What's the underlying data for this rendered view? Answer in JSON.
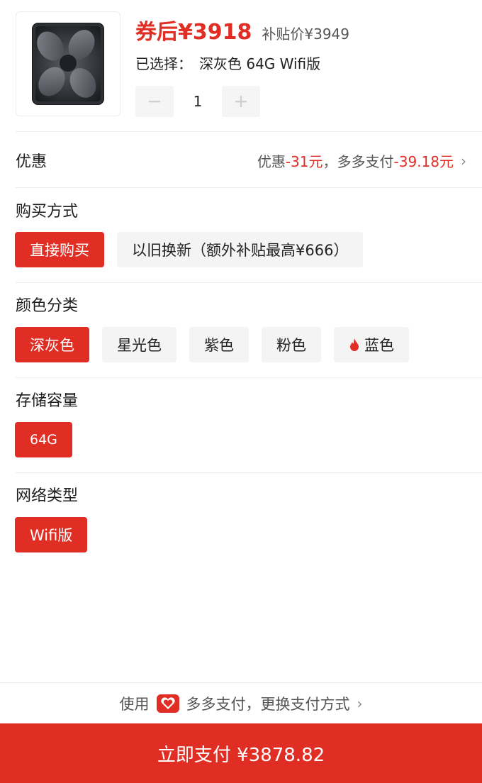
{
  "product": {
    "coupon_price": "券后¥3918",
    "subsidy_price": "补贴价¥3949",
    "selected_label": "已选择：",
    "selected_value": "深灰色 64G Wifi版",
    "quantity": "1",
    "minus_icon": "minus-icon",
    "plus_icon": "plus-icon"
  },
  "discount": {
    "label": "优惠",
    "prefix": "优惠",
    "discount_amount": "-31元",
    "separator": "，多多支付",
    "pay_amount": "-39.18元",
    "chevron": "›"
  },
  "purchase": {
    "title": "购买方式",
    "options": [
      "直接购买",
      "以旧换新（额外补贴最高¥666）"
    ],
    "selected": "直接购买"
  },
  "color": {
    "title": "颜色分类",
    "options": [
      "深灰色",
      "星光色",
      "紫色",
      "粉色",
      "蓝色"
    ],
    "selected": "深灰色",
    "hot_icon": "flame-icon"
  },
  "storage": {
    "title": "存储容量",
    "options": [
      "64G"
    ],
    "selected": "64G"
  },
  "network": {
    "title": "网络类型",
    "options": [
      "Wifi版"
    ],
    "selected": "Wifi版"
  },
  "payment": {
    "use_label": "使用",
    "method_label": "多多支付，更换支付方式",
    "chevron": "›",
    "pay_button": "立即支付 ¥3878.82"
  },
  "colors": {
    "accent": "#e02e24",
    "option_bg": "#f4f4f4"
  }
}
